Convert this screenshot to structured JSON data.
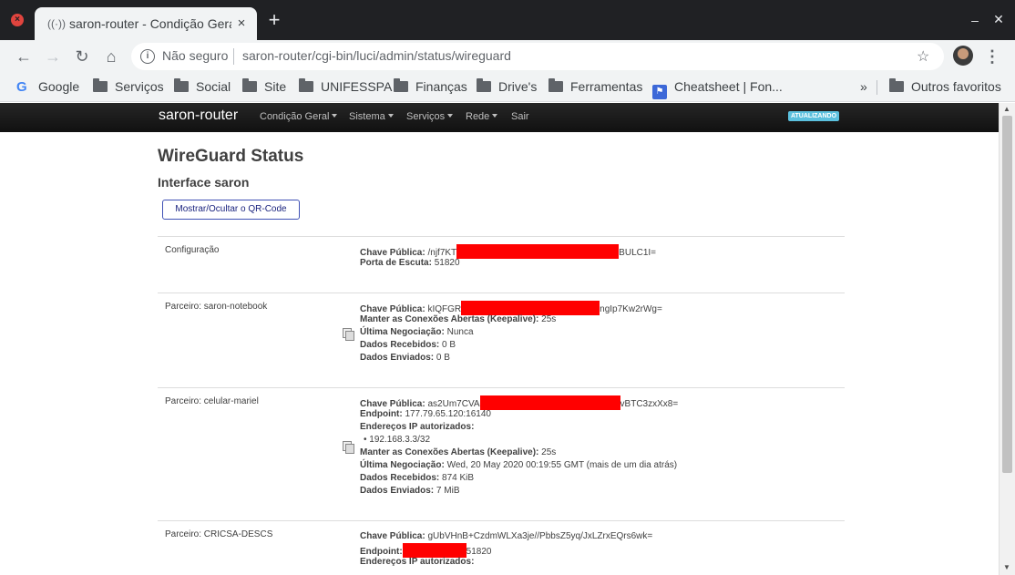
{
  "browser": {
    "tab_title": "saron-router - Condição Geral",
    "omnibox_security": "Não seguro",
    "url": "saron-router/cgi-bin/luci/admin/status/wireguard",
    "bookmarks": [
      "Google",
      "Serviços",
      "Social",
      "Site",
      "UNIFESSPA",
      "Finanças",
      "Drive's",
      "Ferramentas",
      "Cheatsheet | Fon..."
    ],
    "bookmarks_overflow": "»",
    "other_bookmarks": "Outros favoritos"
  },
  "luci": {
    "brand": "saron-router",
    "menu": [
      "Condição Geral",
      "Sistema",
      "Serviços",
      "Rede",
      "Sair"
    ],
    "badge": "ATUALIZANDO"
  },
  "page": {
    "title": "WireGuard Status",
    "interface_title": "Interface saron",
    "qr_button": "Mostrar/Ocultar o QR-Code"
  },
  "config": {
    "label": "Configuração",
    "public_key_label": "Chave Pública:",
    "public_key_start": "/njf7KT",
    "public_key_end": "BULC1I=",
    "listen_port_label": "Porta de Escuta:",
    "listen_port": "51820"
  },
  "peers": [
    {
      "label": "Parceiro: saron-notebook",
      "public_key_label": "Chave Pública:",
      "public_key_start": "kIQFGR",
      "public_key_end": "ngIp7Kw2rWg=",
      "keepalive_label": "Manter as Conexões Abertas (Keepalive):",
      "keepalive": "25s",
      "handshake_label": "Última Negociação:",
      "handshake": "Nunca",
      "received_label": "Dados Recebidos:",
      "received": "0 B",
      "sent_label": "Dados Enviados:",
      "sent": "0 B"
    },
    {
      "label": "Parceiro: celular-mariel",
      "public_key_label": "Chave Pública:",
      "public_key_start": "as2Um7CVA",
      "public_key_end": "vBTC3zxXx8=",
      "endpoint_label": "Endpoint:",
      "endpoint": "177.79.65.120:16140",
      "allowed_ips_label": "Endereços IP autorizados:",
      "allowed_ip": "• 192.168.3.3/32",
      "keepalive_label": "Manter as Conexões Abertas (Keepalive):",
      "keepalive": "25s",
      "handshake_label": "Última Negociação:",
      "handshake": "Wed, 20 May 2020 00:19:55 GMT (mais de um dia atrás)",
      "received_label": "Dados Recebidos:",
      "received": "874 KiB",
      "sent_label": "Dados Enviados:",
      "sent": "7 MiB"
    },
    {
      "label": "Parceiro: CRICSA-DESCS",
      "public_key_label": "Chave Pública:",
      "public_key": "gUbVHnB+CzdmWLXa3je//PbbsZ5yq/JxLZrxEQrs6wk=",
      "endpoint_label": "Endpoint:",
      "endpoint_end": "51820",
      "allowed_ips_label": "Endereços IP autorizados:"
    }
  ]
}
